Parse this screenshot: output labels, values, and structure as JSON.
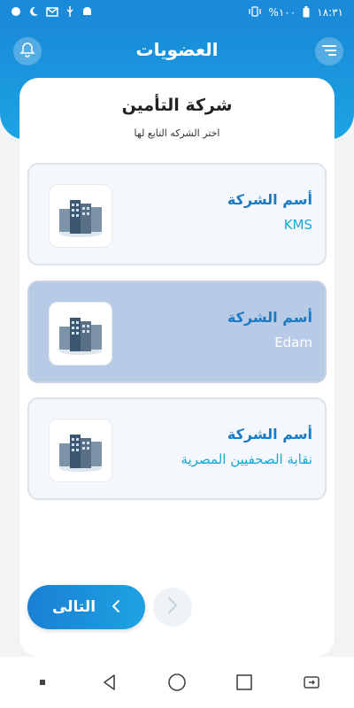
{
  "status_bar": {
    "time": "١٨:٣١",
    "battery": "%١٠٠",
    "icons_left": [
      "circle-icon",
      "moon-icon",
      "gmail-icon",
      "usb-icon",
      "android-icon"
    ],
    "icons_right": [
      "vibrate-icon",
      "battery-icon"
    ]
  },
  "header": {
    "title": "العضويات",
    "bell_icon": "bell-icon",
    "menu_icon": "menu-icon"
  },
  "card": {
    "title": "شركة التأمين",
    "subtitle": "اختر الشركه التابع لها"
  },
  "companies": [
    {
      "label": "أسم الشركة",
      "name": "KMS",
      "selected": false,
      "icon": "building-icon"
    },
    {
      "label": "أسم الشركة",
      "name": "Edam",
      "selected": true,
      "icon": "building-icon"
    },
    {
      "label": "أسم الشركة",
      "name": "نقابة الصحفيين المصرية",
      "selected": false,
      "icon": "building-icon"
    }
  ],
  "buttons": {
    "next_label": "التالى",
    "next_icon": "chevron-left-icon",
    "back_icon": "chevron-right-icon"
  },
  "nav_bar": {
    "icons": [
      "recents-dot-icon",
      "back-triangle-icon",
      "home-circle-icon",
      "overview-square-icon",
      "rotate-screen-icon"
    ]
  },
  "colors": {
    "primary": "#1a8bd8",
    "accent": "#1aa7d8",
    "selected_bg": "#b7cae6"
  }
}
